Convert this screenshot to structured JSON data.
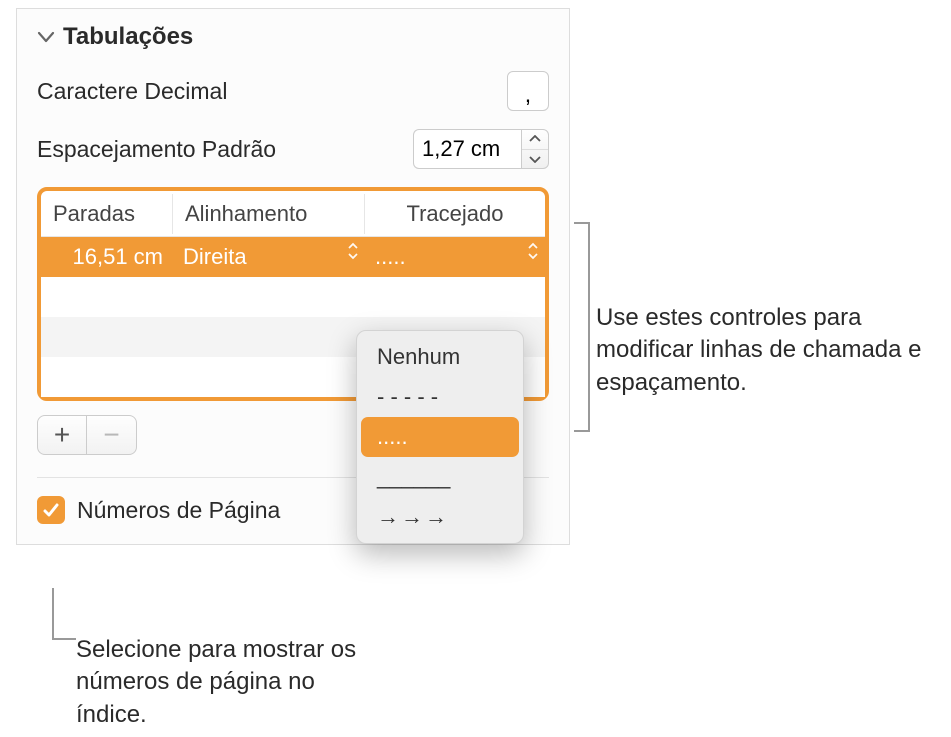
{
  "section": {
    "title": "Tabulações"
  },
  "decimal": {
    "label": "Caractere Decimal",
    "value": ","
  },
  "spacing": {
    "label": "Espacejamento Padrão",
    "value": "1,27 cm"
  },
  "table": {
    "headers": {
      "stops": "Paradas",
      "alignment": "Alinhamento",
      "leader": "Tracejado"
    },
    "row": {
      "stop": "16,51 cm",
      "alignment": "Direita",
      "leader": "....."
    }
  },
  "dropdown": {
    "items": {
      "none": "Nenhum",
      "dashes": "- - - - -",
      "dots": ".....",
      "solid": "______",
      "arrows": "→→→"
    }
  },
  "checkbox": {
    "label": "Números de Página"
  },
  "callouts": {
    "right": "Use estes controles para modificar linhas de chamada e espaçamento.",
    "bottom": "Selecione para mostrar os números de página no índice."
  }
}
